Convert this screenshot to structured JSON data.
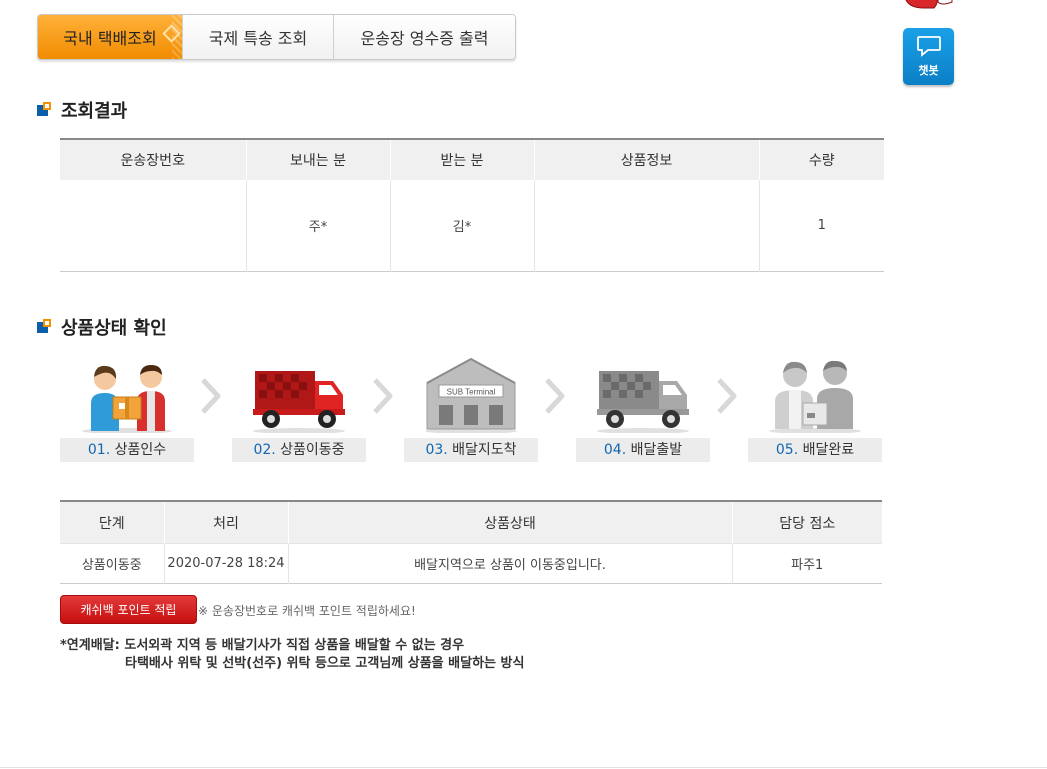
{
  "tabs": [
    {
      "label": "국내 택배조회",
      "active": true
    },
    {
      "label": "국제 특송 조회",
      "active": false
    },
    {
      "label": "운송장 영수증 출력",
      "active": false
    }
  ],
  "chatbot": {
    "label": "챗봇"
  },
  "result": {
    "title": "조회결과",
    "headers": [
      "운송장번호",
      "보내는 분",
      "받는 분",
      "상품정보",
      "수량"
    ],
    "row": [
      "",
      "주*",
      "김*",
      "",
      "1"
    ]
  },
  "progress": {
    "title": "상품상태 확인",
    "steps": [
      {
        "num": "01.",
        "label": "상품인수"
      },
      {
        "num": "02.",
        "label": "상품이동중"
      },
      {
        "num": "03.",
        "label": "배달지도착"
      },
      {
        "num": "04.",
        "label": "배달출발"
      },
      {
        "num": "05.",
        "label": "배달완료"
      }
    ],
    "terminal_sign": "SUB Terminal"
  },
  "status": {
    "headers": [
      "단계",
      "처리",
      "상품상태",
      "담당 점소"
    ],
    "row": [
      "상품이동중",
      "2020-07-28 18:24",
      "배달지역으로 상품이 이동중입니다.",
      "파주1"
    ]
  },
  "cashback": {
    "button": "캐쉬백 포인트 적립",
    "note": "※ 운송장번호로 캐쉬백 포인트 적립하세요!"
  },
  "notes": {
    "line1": "*연계배달: 도서외곽 지역 등 배달기사가 직접 상품을 배달할 수 없는 경우",
    "line2": "타택배사 위탁 및 선박(선주) 위탁 등으로 고객님께 상품을 배달하는 방식"
  },
  "colors": {
    "accent": "#f08c00",
    "brand_blue": "#0d5ea9",
    "button_red": "#c70f0f",
    "chatbot_blue": "#0b7fc6"
  }
}
